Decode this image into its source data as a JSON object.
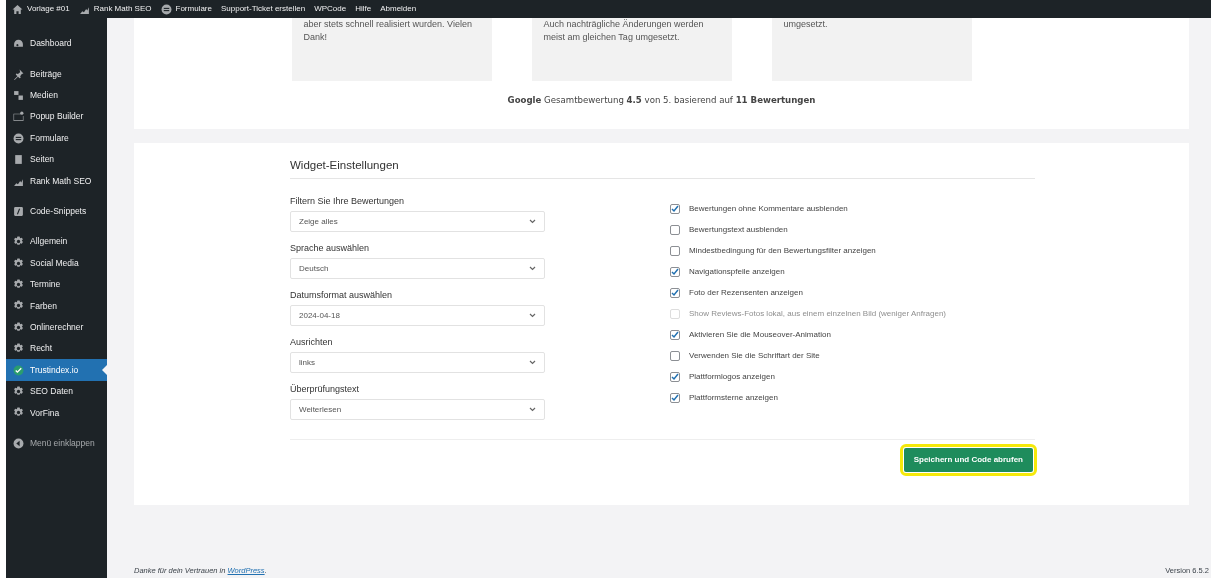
{
  "admin_bar": [
    {
      "label": "Vorlage #01"
    },
    {
      "label": "Rank Math SEO"
    },
    {
      "label": "Formulare"
    },
    {
      "label": "Support-Ticket erstellen"
    },
    {
      "label": "WPCode"
    },
    {
      "label": "Hilfe"
    },
    {
      "label": "Abmelden"
    }
  ],
  "sidebar": {
    "groups": [
      [
        {
          "label": "Dashboard",
          "selected": false
        }
      ],
      [
        {
          "label": "Beiträge",
          "selected": false
        },
        {
          "label": "Medien",
          "selected": false
        },
        {
          "label": "Popup Builder",
          "selected": false
        },
        {
          "label": "Formulare",
          "selected": false
        },
        {
          "label": "Seiten",
          "selected": false
        },
        {
          "label": "Rank Math SEO",
          "selected": false
        }
      ],
      [
        {
          "label": "Code-Snippets",
          "selected": false
        }
      ],
      [
        {
          "label": "Allgemein",
          "selected": false
        },
        {
          "label": "Social Media",
          "selected": false
        },
        {
          "label": "Termine",
          "selected": false
        },
        {
          "label": "Farben",
          "selected": false
        },
        {
          "label": "Onlinerechner",
          "selected": false
        },
        {
          "label": "Recht",
          "selected": false
        },
        {
          "label": "Trustindex.io",
          "selected": true
        },
        {
          "label": "SEO Daten",
          "selected": false
        },
        {
          "label": "VorFina",
          "selected": false
        }
      ]
    ],
    "collapse": "Menü einklappen"
  },
  "reviews": [
    {
      "lines": [
        "aber stets schnell realisiert wurden. Vielen",
        "Dank!"
      ]
    },
    {
      "lines": [
        "Auch nachträgliche Änderungen werden",
        "meist am gleichen Tag umgesetzt."
      ]
    },
    {
      "lines": [
        "umgesetzt."
      ]
    }
  ],
  "rating_summary": "**Google** Gesamtbewertung **4.5** von 5. basierend auf **11 Bewertungen**",
  "settings": {
    "title": "Widget-Einstellungen",
    "selects": [
      {
        "label": "Filtern Sie Ihre Bewertungen",
        "value": "Zeige alles"
      },
      {
        "label": "Sprache auswählen",
        "value": "Deutsch"
      },
      {
        "label": "Datumsformat auswählen",
        "value": "2024-04-18"
      },
      {
        "label": "Ausrichten",
        "value": "links"
      },
      {
        "label": "Überprüfungstext",
        "value": "Weiterlesen"
      }
    ],
    "checkboxes": [
      {
        "label": "Bewertungen ohne Kommentare ausblenden",
        "checked": true,
        "disabled": false
      },
      {
        "label": "Bewertungstext ausblenden",
        "checked": false,
        "disabled": false
      },
      {
        "label": "Mindestbedingung für den Bewertungsfilter anzeigen",
        "checked": false,
        "disabled": false
      },
      {
        "label": "Navigationspfeile anzeigen",
        "checked": true,
        "disabled": false
      },
      {
        "label": "Foto der Rezensenten anzeigen",
        "checked": true,
        "disabled": false
      },
      {
        "label": "Show Reviews-Fotos lokal, aus einem einzelnen Bild (weniger Anfragen)",
        "checked": false,
        "disabled": true
      },
      {
        "label": "Aktivieren Sie die Mouseover-Animation",
        "checked": true,
        "disabled": false
      },
      {
        "label": "Verwenden Sie die Schriftart der Site",
        "checked": false,
        "disabled": false
      },
      {
        "label": "Plattformlogos anzeigen",
        "checked": true,
        "disabled": false
      },
      {
        "label": "Plattformsterne anzeigen",
        "checked": true,
        "disabled": false
      }
    ],
    "save_button": {
      "label": "Speichern und Code abrufen",
      "highlighted": true
    }
  },
  "footer": {
    "text": "Danke für dein Vertrauen in ",
    "link": "WordPress",
    "after": ".",
    "version": "Version 6.5.2"
  }
}
